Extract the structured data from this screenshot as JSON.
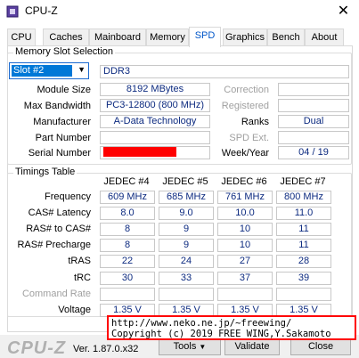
{
  "window": {
    "title": "CPU-Z",
    "close_glyph": "✕"
  },
  "tabs": [
    {
      "label": "CPU"
    },
    {
      "label": "Caches"
    },
    {
      "label": "Mainboard"
    },
    {
      "label": "Memory"
    },
    {
      "label": "SPD"
    },
    {
      "label": "Graphics"
    },
    {
      "label": "Bench"
    },
    {
      "label": "About"
    }
  ],
  "active_tab": "SPD",
  "slot_group": {
    "title": "Memory Slot Selection",
    "slot_selected": "Slot #2",
    "mem_type": "DDR3",
    "labels": {
      "module_size": "Module Size",
      "max_bandwidth": "Max Bandwidth",
      "manufacturer": "Manufacturer",
      "part_number": "Part Number",
      "serial_number": "Serial Number",
      "correction": "Correction",
      "registered": "Registered",
      "ranks": "Ranks",
      "spd_ext": "SPD Ext.",
      "week_year": "Week/Year"
    },
    "values": {
      "module_size": "8192 MBytes",
      "max_bandwidth": "PC3-12800 (800 MHz)",
      "manufacturer": "A-Data Technology",
      "part_number": "",
      "correction": "",
      "registered": "",
      "ranks": "Dual",
      "spd_ext": "",
      "week_year": "04 / 19"
    }
  },
  "timings": {
    "title": "Timings Table",
    "columns": [
      "JEDEC #4",
      "JEDEC #5",
      "JEDEC #6",
      "JEDEC #7"
    ],
    "rows": [
      {
        "label": "Frequency",
        "values": [
          "609 MHz",
          "685 MHz",
          "761 MHz",
          "800 MHz"
        ]
      },
      {
        "label": "CAS# Latency",
        "values": [
          "8.0",
          "9.0",
          "10.0",
          "11.0"
        ]
      },
      {
        "label": "RAS# to CAS#",
        "values": [
          "8",
          "9",
          "10",
          "11"
        ]
      },
      {
        "label": "RAS# Precharge",
        "values": [
          "8",
          "9",
          "10",
          "11"
        ]
      },
      {
        "label": "tRAS",
        "values": [
          "22",
          "24",
          "27",
          "28"
        ]
      },
      {
        "label": "tRC",
        "values": [
          "30",
          "33",
          "37",
          "39"
        ]
      },
      {
        "label": "Command Rate",
        "values": [
          "",
          "",
          "",
          ""
        ]
      },
      {
        "label": "Voltage",
        "values": [
          "1.35 V",
          "1.35 V",
          "1.35 V",
          "1.35 V"
        ]
      }
    ]
  },
  "footer": {
    "logo": "CPU-Z",
    "version": "Ver. 1.87.0.x32",
    "tools_label": "Tools",
    "validate_label": "Validate",
    "close_label": "Close"
  },
  "overlay": {
    "line1": "http://www.neko.ne.jp/~freewing/",
    "line2": "Copyright (c) 2019 FREE WING,Y.Sakamoto"
  }
}
